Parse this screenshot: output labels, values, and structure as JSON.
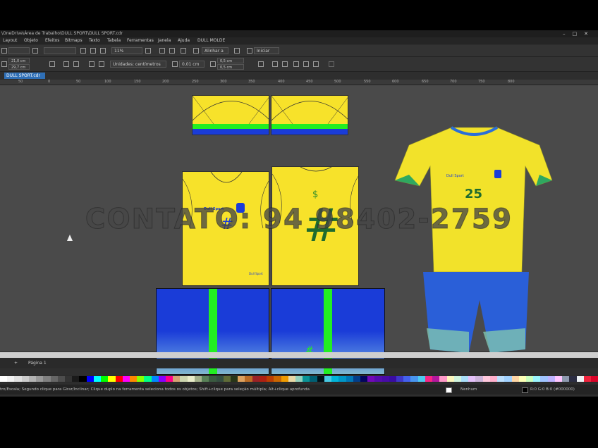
{
  "window": {
    "title": "\\OneDrive\\Área de Trabalho\\DULL SPORT\\DULL SPORT.cdr",
    "controls": [
      "–",
      "□",
      "✕"
    ]
  },
  "menu": [
    "Layout",
    "Objeto",
    "Efeitos",
    "Bitmaps",
    "Texto",
    "Tabela",
    "Ferramentas",
    "Janela",
    "Ajuda",
    "DULL MOLDE"
  ],
  "toolbar": {
    "zoom": "11%",
    "align": "Alinhar a",
    "launch": "Iniciar",
    "width": "21,0 cm",
    "height": "29,7 cm",
    "units": "Unidades: centímetros",
    "nudge": "0,01 cm",
    "dup_x": "0,5 cm",
    "dup_y": "0,5 cm"
  },
  "document_tab": "DULL SPORT.cdr",
  "ruler_ticks": [
    "50",
    "0",
    "50",
    "100",
    "150",
    "200",
    "250",
    "300",
    "350",
    "400",
    "450",
    "500",
    "550",
    "600",
    "650",
    "700",
    "750",
    "800"
  ],
  "canvas": {
    "watermark": "CONTATO: 94 98402-2759",
    "jersey_number": "25",
    "hash_symbol": "#",
    "dollar_symbol": "$",
    "brand_text": "Dull Sport"
  },
  "page": {
    "add": "+",
    "name": "Página 1"
  },
  "status": {
    "hint": "tro/Escala; Segundo clique para Girar/Inclinar; Clique duplo na ferramenta seleciona todos os objetos; Shift+clique para seleção múltipla; Alt+clique aprofunda",
    "fill": "Nenhum",
    "color": "R:0 G:0 B:0 (#000000)"
  },
  "colors": {
    "yellow": "#f7e22a",
    "blue": "#1a3cd8",
    "green": "#22ee22",
    "accent": "#2f6fb6"
  },
  "palette": [
    "#ffffff",
    "#f2f2f2",
    "#e0e0e0",
    "#cccccc",
    "#b3b3b3",
    "#999999",
    "#808080",
    "#666666",
    "#4d4d4d",
    "#333333",
    "#1a1a1a",
    "#000000",
    "#0000ff",
    "#00ffff",
    "#00ff00",
    "#ffff00",
    "#ff0000",
    "#ff00ff",
    "#ff8800",
    "#88ff00",
    "#00ff88",
    "#0088ff",
    "#8800ff",
    "#ff0088",
    "#d4a373",
    "#ccd5ae",
    "#e9edc9",
    "#a3b18a",
    "#588157",
    "#3a5a40",
    "#344e41",
    "#606c38",
    "#283618",
    "#dda15e",
    "#bc6c25",
    "#9b2226",
    "#ae2012",
    "#bb3e03",
    "#ca6702",
    "#ee9b00",
    "#e9d8a6",
    "#94d2bd",
    "#0a9396",
    "#005f73",
    "#001219",
    "#48cae4",
    "#00b4d8",
    "#0096c7",
    "#0077b6",
    "#023e8a",
    "#03045e",
    "#7209b7",
    "#560bad",
    "#480ca8",
    "#3a0ca3",
    "#3f37c9",
    "#4361ee",
    "#4895ef",
    "#4cc9f0",
    "#f72585",
    "#b5179e",
    "#ff99c8",
    "#fcf6bd",
    "#d0f4de",
    "#a9def9",
    "#e4c1f9",
    "#cdb4db",
    "#ffc8dd",
    "#ffafcc",
    "#bde0fe",
    "#a2d2ff",
    "#ffd6a5",
    "#fdffb6",
    "#caffbf",
    "#9bf6ff",
    "#a0c4ff",
    "#bdb2ff",
    "#ffc6ff",
    "#8d99ae",
    "#2b2d42",
    "#edf2f4",
    "#ef233c",
    "#d90429"
  ]
}
